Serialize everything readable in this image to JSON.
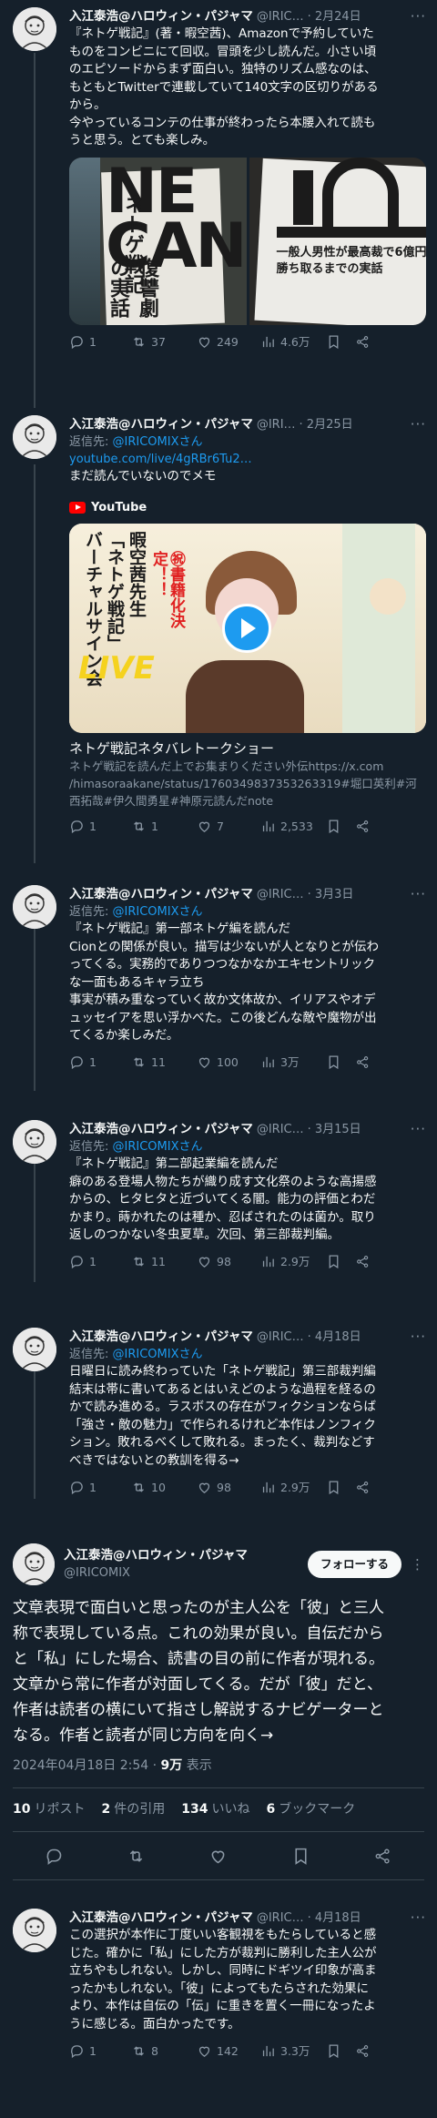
{
  "tweets": [
    {
      "name": "入江泰浩@ハロウィン・パジャマ",
      "handle": "@IRIC…",
      "date": "· 2月24日",
      "text": "『ネトゲ戦記』(著・暇空茜)、Amazonで予約していた\nものをコンビニにて回収。冒頭を少し読んだ。小さい頃\nのエピソードからまず面白い。独特のリズム感なのは、\nもともとTwitterで連載していて140文字の区切りがある\nから。\n今やっているコンテの仕事が終わったら本腰入れて読も\nうと思う。とても楽しみ。",
      "photo_left_text": "ネトゲ戦記",
      "photo_left_sub": "の実話",
      "photo_left_sub2": "復讐劇",
      "photo_right_text": "一般人男性が最高裁で6億円\n勝ち取るまでの実話",
      "replies": "1",
      "retweets": "37",
      "likes": "249",
      "views": "4.6万"
    },
    {
      "name": "入江泰浩@ハロウィン・パジャマ",
      "handle": "@IRI…",
      "date": "· 2月25日",
      "reply_label": "返信先: ",
      "reply_target": "@IRICOMIXさん",
      "link": "youtube.com/live/4gRBr6Tu2…",
      "text": "まだ読んでいないのでメモ",
      "yt_label": "YouTube",
      "thumb_banner": "暇空茜先生\n「ネトゲ戦記」\nバーチャルサイン会",
      "thumb_badge": "㊗書籍化決定！！",
      "thumb_live": "LIVE",
      "card_title": "ネトゲ戦記ネタバレトークショー",
      "card_desc": "ネトゲ戦記を読んだ上でお集まりください外伝https://x.com\n/himasoraakane/status/1760349837353263319#堀口英利#河\n西拓哉#伊久間勇星#神原元読んだnote",
      "replies": "1",
      "retweets": "1",
      "likes": "7",
      "views": "2,533"
    },
    {
      "name": "入江泰浩@ハロウィン・パジャマ",
      "handle": "@IRIC…",
      "date": "· 3月3日",
      "reply_label": "返信先: ",
      "reply_target": "@IRICOMIXさん",
      "text": "『ネトゲ戦記』第一部ネトゲ編を読んだ\nCionとの関係が良い。描写は少ないが人となりとが伝わ\nってくる。実務的でありつつなかなかエキセントリック\nな一面もあるキャラ立ち\n事実が積み重なっていく故か文体故か、イリアスやオデ\nュッセイアを思い浮かべた。この後どんな敵や魔物が出\nてくるか楽しみだ。",
      "replies": "1",
      "retweets": "11",
      "likes": "100",
      "views": "3万"
    },
    {
      "name": "入江泰浩@ハロウィン・パジャマ",
      "handle": "@IRIC…",
      "date": "· 3月15日",
      "reply_label": "返信先: ",
      "reply_target": "@IRICOMIXさん",
      "text": "『ネトゲ戦記』第二部起業編を読んだ\n癖のある登場人物たちが織り成す文化祭のような高揚感\nからの、ヒタヒタと近づいてくる闇。能力の評価とわだ\nかまり。蒔かれたのは種か、忍ばされたのは菌か。取り\n返しのつかない冬虫夏草。次回、第三部裁判編。",
      "replies": "1",
      "retweets": "11",
      "likes": "98",
      "views": "2.9万"
    },
    {
      "name": "入江泰浩@ハロウィン・パジャマ",
      "handle": "@IRIC…",
      "date": "· 4月18日",
      "reply_label": "返信先: ",
      "reply_target": "@IRICOMIXさん",
      "text": "日曜日に読み終わっていた「ネトゲ戦記」第三部裁判編\n結末は帯に書いてあるとはいえどのような過程を経るの\nかで読み進める。ラスボスの存在がフィクションならば\n「強さ・敵の魅力」で作られるけれど本作はノンフィク\nション。敗れるべくして敗れる。まったく、裁判などす\nべきではないとの教訓を得る→",
      "replies": "1",
      "retweets": "10",
      "likes": "98",
      "views": "2.9万"
    }
  ],
  "main": {
    "name": "入江泰浩@ハロウィン・パジャマ",
    "handle": "@IRICOMIX",
    "follow_label": "フォローする",
    "text": "文章表現で面白いと思ったのが主人公を「彼」と三人\n称で表現している点。これの効果が良い。自伝だから\nと「私」にした場合、読書の目の前に作者が現れる。\n文章から常に作者が対面してくる。だが「彼」だと、\n作者は読者の横にいて指さし解説するナビゲーターと\nなる。作者と読者が同じ方向を向く→",
    "timestamp": "2024年04月18日 2:54",
    "dot": " · ",
    "views_count": "9万",
    "views_label": "表示",
    "stats": [
      {
        "count": "10",
        "label": "リポスト"
      },
      {
        "count": "2",
        "label": "件の引用"
      },
      {
        "count": "134",
        "label": "いいね"
      },
      {
        "count": "6",
        "label": "ブックマーク"
      }
    ]
  },
  "last": {
    "name": "入江泰浩@ハロウィン・パジャマ",
    "handle": "@IRIC…",
    "date": "· 4月18日",
    "text": "この選択が本作に丁度いい客観視をもたらしていると感\nじた。確かに「私」にした方が裁判に勝利した主人公が\n立ちやもしれない。しかし、同時にドギツイ印象が高ま\nったかもしれない。「彼」によってもたらされた効果に\nより、本作は自伝の「伝」に重きを置く一冊になったよ\nうに感じる。面白かったです。",
    "replies": "1",
    "retweets": "8",
    "likes": "142",
    "views": "3.3万"
  },
  "colors": {
    "background": "#15202b",
    "accent": "#1d9bf0",
    "muted": "#8b98a5",
    "divider": "#38444d"
  }
}
